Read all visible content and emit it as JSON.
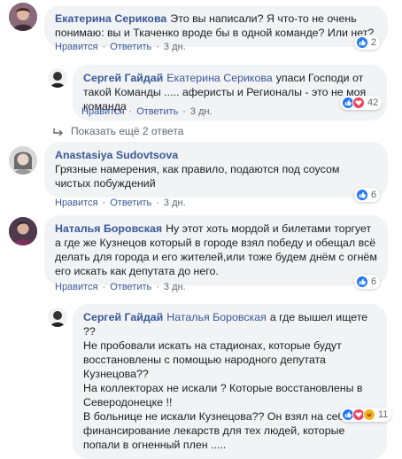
{
  "comments": [
    {
      "author": "Екатерина Серикова",
      "text": "Это вы написали? Я что-то не очень понимаю: вы и Ткаченко вроде бы в одной команде? Или нет?",
      "like_label": "Нравится",
      "reply_label": "Ответить",
      "time": "3 дн.",
      "reaction_count": "2"
    },
    {
      "author": "Сергей Гайдай",
      "mention": "Екатерина Серикова",
      "text": "упаси Господи от такой Команды ..... аферисты и Регионалы - это не моя команда",
      "like_label": "Нравится",
      "reply_label": "Ответить",
      "time": "3 дн.",
      "reaction_count": "42"
    },
    {
      "author": "Anastasiya Sudovtsova",
      "text": "Грязные намерения, как правило, подаются под соусом чистых побуждений",
      "like_label": "Нравится",
      "reply_label": "Ответить",
      "time": "3 дн.",
      "reaction_count": "6"
    },
    {
      "author": "Наталья Боровская",
      "text": "Ну этот хоть мордой и билетами торгует а где же Кузнецов который в городе взял победу и обещал всё делать для города и его жителей,или тоже будем днём с огнём его искать как депутата до него.",
      "like_label": "Нравится",
      "reply_label": "Ответить",
      "time": "3 дн.",
      "reaction_count": "6"
    },
    {
      "author": "Сергей Гайдай",
      "mention": "Наталья Боровская",
      "text_lines": [
        "а где вышел ищете ??",
        "Не пробовали искать на стадионах, которые будут восстановлены с помощью народного депутата Кузнецова??",
        "На коллекторах не искали ? Которые восстановлены в Северодонецке !!",
        "В больнице не искали Кузнецова?? Он взял на себя финансирование лекарств для тех людей, которые попали в огненный плен ....."
      ],
      "reaction_count": "11"
    }
  ],
  "show_more": {
    "label": "Показать ещё 2 ответа"
  },
  "colors": {
    "link": "#385898",
    "bubble": "#f2f3f5",
    "meta": "#606770",
    "like": "#2078f4",
    "love": "#f33e58",
    "haha": "#f7b125"
  }
}
